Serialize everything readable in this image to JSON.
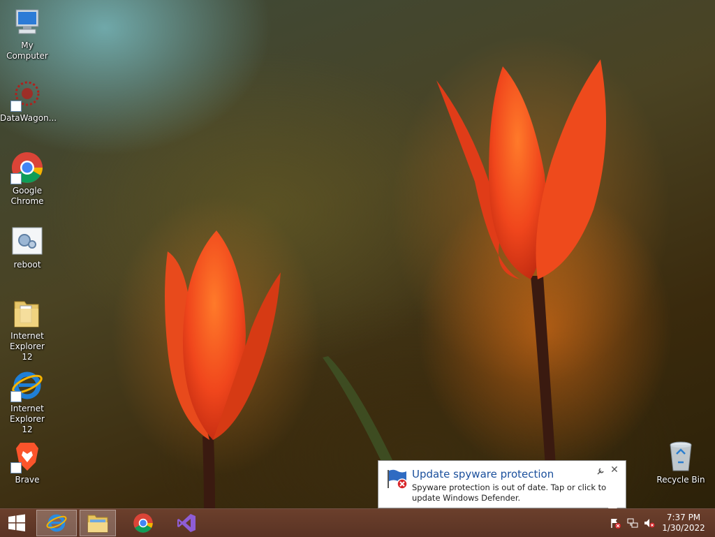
{
  "desktop": {
    "icons": [
      {
        "label": "My Computer",
        "icon": "computer-icon"
      },
      {
        "label": "DataWagon...",
        "icon": "datawagon-icon"
      },
      {
        "label": "Google Chrome",
        "icon": "chrome-icon"
      },
      {
        "label": "reboot",
        "icon": "reboot-icon"
      },
      {
        "label": "Internet Explorer 12",
        "icon": "folder-icon"
      },
      {
        "label": "Internet Explorer 12",
        "icon": "internet-explorer-icon"
      },
      {
        "label": "Brave",
        "icon": "brave-icon"
      }
    ],
    "recycle_bin": {
      "label": "Recycle Bin",
      "icon": "recycle-bin-icon"
    }
  },
  "notification": {
    "title": "Update spyware protection",
    "message": "Spyware protection is out of date. Tap or click to update Windows Defender.",
    "icon": "windows-defender-flag-icon"
  },
  "taskbar": {
    "pinned": [
      {
        "name": "start",
        "icon": "windows-logo-icon"
      },
      {
        "name": "internet-explorer",
        "icon": "internet-explorer-icon"
      },
      {
        "name": "file-explorer",
        "icon": "file-explorer-icon"
      },
      {
        "name": "chrome",
        "icon": "chrome-icon"
      },
      {
        "name": "visual-studio",
        "icon": "visual-studio-icon"
      }
    ],
    "tray": {
      "time": "7:37 PM",
      "date": "1/30/2022",
      "icons": [
        "action-center-flag-icon",
        "network-icon",
        "volume-muted-icon"
      ]
    }
  },
  "colors": {
    "taskbar": "#5f3727",
    "notification_title": "#1a4f9c",
    "tulip": "#f0461c"
  }
}
